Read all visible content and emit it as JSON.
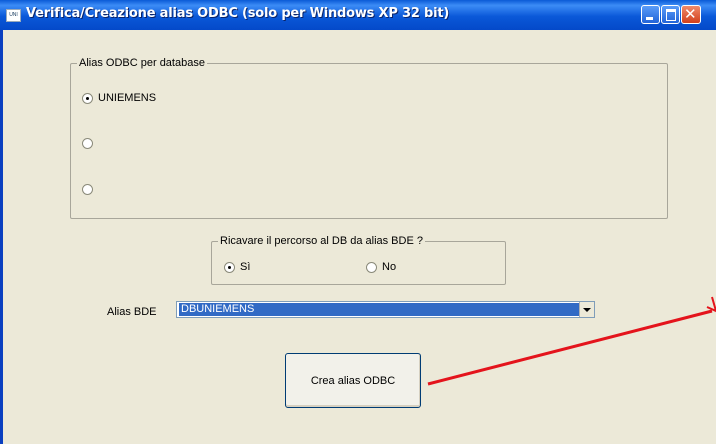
{
  "window": {
    "title": "Verifica/Creazione alias ODBC (solo per Windows XP 32 bit)"
  },
  "database_group": {
    "legend": "Alias ODBC per database",
    "options": [
      {
        "label": "UNIEMENS",
        "checked": true
      },
      {
        "label": "",
        "checked": false
      },
      {
        "label": "",
        "checked": false
      }
    ]
  },
  "path_group": {
    "legend": "Ricavare il percorso al DB da alias BDE ?",
    "yes_label": "Sì",
    "no_label": "No",
    "selected": "Sì"
  },
  "alias_bde": {
    "label": "Alias BDE",
    "value": "DBUNIEMENS"
  },
  "create_button": {
    "label": "Crea alias ODBC"
  },
  "annotation": {
    "color": "#e4141c"
  }
}
